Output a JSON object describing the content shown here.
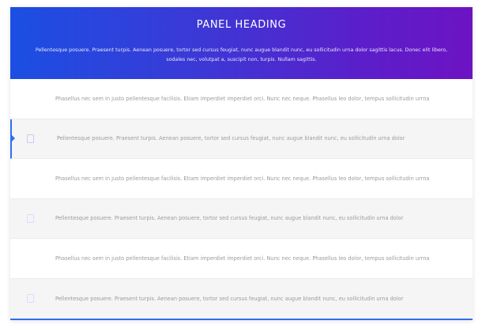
{
  "panel": {
    "title": "PANEL HEADING",
    "subtitle": "Pellentesque posuere. Praesent turpis. Aenean posuere, tortor sed cursus feugiat, nunc augue blandit nunc, eu sollicitudin urna dolor sagittis lacus. Donec elit libero, sodales nec, volutpat a, suscipit non, turpis. Nullam sagittis."
  },
  "rows": [
    {
      "text": "Phasellus nec sem in justo pellentesque facilisis. Etiam imperdiet imperdiet orci. Nunc nec neque. Phasellus leo dolor, tempus sollicitudin urrna",
      "has_checkbox": false,
      "active": false
    },
    {
      "text": "Pellentesque posuere. Praesent turpis. Aenean posuere, tortor sed cursus feugiat, nunc augue blandit nunc, eu sollicitudin urna dolor",
      "has_checkbox": true,
      "active": true
    },
    {
      "text": "Phasellus nec sem in justo pellentesque facilisis. Etiam imperdiet imperdiet orci. Nunc nec neque. Phasellus leo dolor, tempus sollicitudin urrna",
      "has_checkbox": false,
      "active": false
    },
    {
      "text": "Pellentesque posuere. Praesent turpis. Aenean posuere, tortor sed cursus feugiat, nunc augue blandit nunc, eu sollicitudin urna dolor",
      "has_checkbox": true,
      "active": false
    },
    {
      "text": "Phasellus nec sem in justo pellentesque facilisis. Etiam imperdiet imperdiet orci. Nunc nec neque. Phasellus leo dolor, tempus sollicitudin urrna",
      "has_checkbox": false,
      "active": false
    },
    {
      "text": "Pellentesque posuere. Praesent turpis. Aenean posuere, tortor sed cursus feugiat, nunc augue blandit nunc, eu sollicitudin urna dolor",
      "has_checkbox": true,
      "active": false
    }
  ],
  "colors": {
    "header_gradient_start": "#1b4fe3",
    "header_gradient_end": "#6d13c3",
    "accent": "#2f6ff0",
    "row_alt_bg": "#f5f5f5",
    "row_text": "#9b9b9b"
  }
}
